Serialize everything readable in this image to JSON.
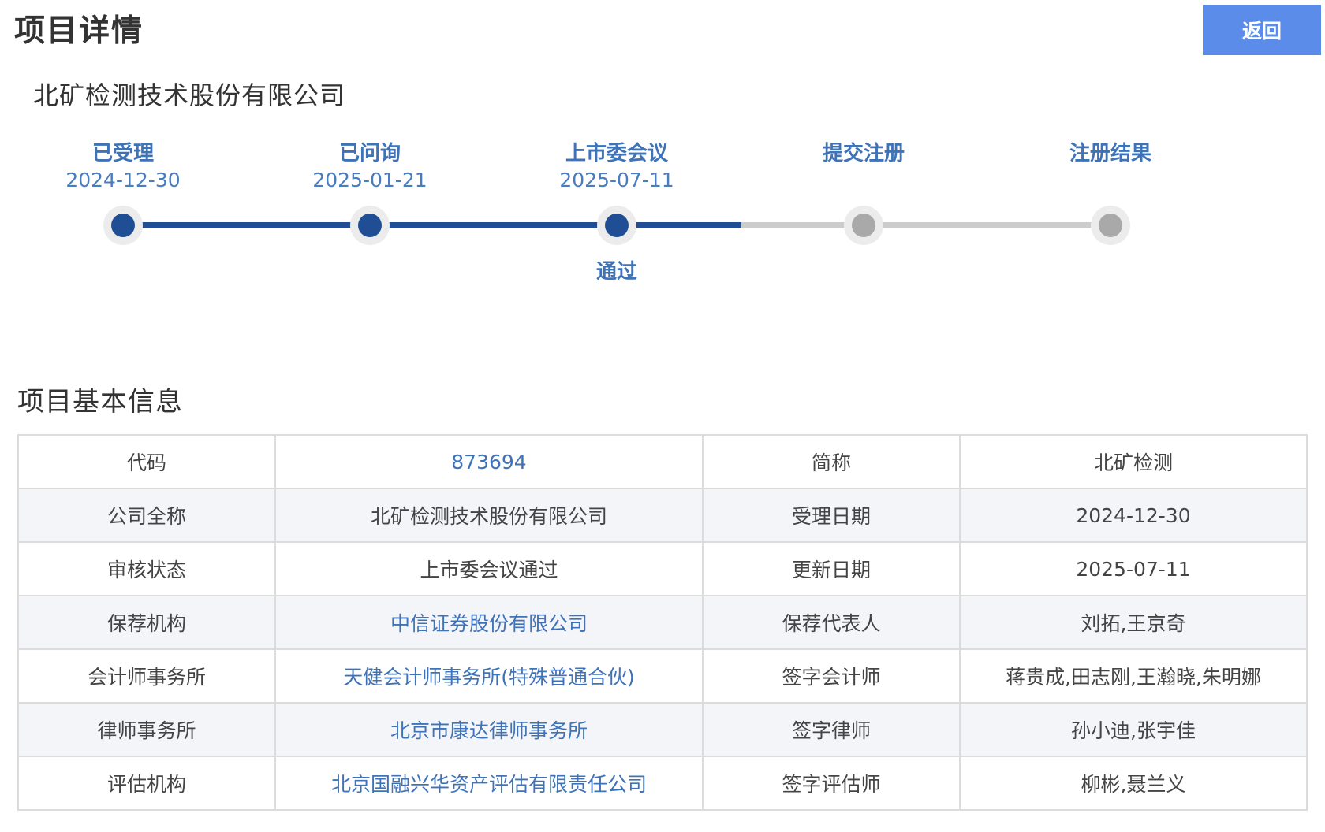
{
  "header": {
    "title": "项目详情",
    "back_label": "返回"
  },
  "company_name": "北矿检测技术股份有限公司",
  "progress": {
    "current_step": 3,
    "fill_fraction": 0.626,
    "colors": {
      "done": "#1f4e95",
      "todo": "#cccccc",
      "label": "#3f73b8"
    },
    "steps": [
      {
        "label": "已受理",
        "date": "2024-12-30",
        "result": "",
        "done": true
      },
      {
        "label": "已问询",
        "date": "2025-01-21",
        "result": "",
        "done": true
      },
      {
        "label": "上市委会议",
        "date": "2025-07-11",
        "result": "通过",
        "done": true
      },
      {
        "label": "提交注册",
        "date": "",
        "result": "",
        "done": false
      },
      {
        "label": "注册结果",
        "date": "",
        "result": "",
        "done": false
      }
    ]
  },
  "section_title": "项目基本信息",
  "info_table": {
    "rows": [
      {
        "k1": "代码",
        "v1": "873694",
        "v1_link": true,
        "k2": "简称",
        "v2": "北矿检测"
      },
      {
        "k1": "公司全称",
        "v1": "北矿检测技术股份有限公司",
        "v1_link": false,
        "k2": "受理日期",
        "v2": "2024-12-30"
      },
      {
        "k1": "审核状态",
        "v1": "上市委会议通过",
        "v1_link": false,
        "k2": "更新日期",
        "v2": "2025-07-11"
      },
      {
        "k1": "保荐机构",
        "v1": "中信证券股份有限公司",
        "v1_link": true,
        "k2": "保荐代表人",
        "v2": "刘拓,王京奇"
      },
      {
        "k1": "会计师事务所",
        "v1": "天健会计师事务所(特殊普通合伙)",
        "v1_link": true,
        "k2": "签字会计师",
        "v2": "蒋贵成,田志刚,王瀚晓,朱明娜"
      },
      {
        "k1": "律师事务所",
        "v1": "北京市康达律师事务所",
        "v1_link": true,
        "k2": "签字律师",
        "v2": "孙小迪,张宇佳"
      },
      {
        "k1": "评估机构",
        "v1": "北京国融兴华资产评估有限责任公司",
        "v1_link": true,
        "k2": "签字评估师",
        "v2": "柳彬,聂兰义"
      }
    ]
  }
}
